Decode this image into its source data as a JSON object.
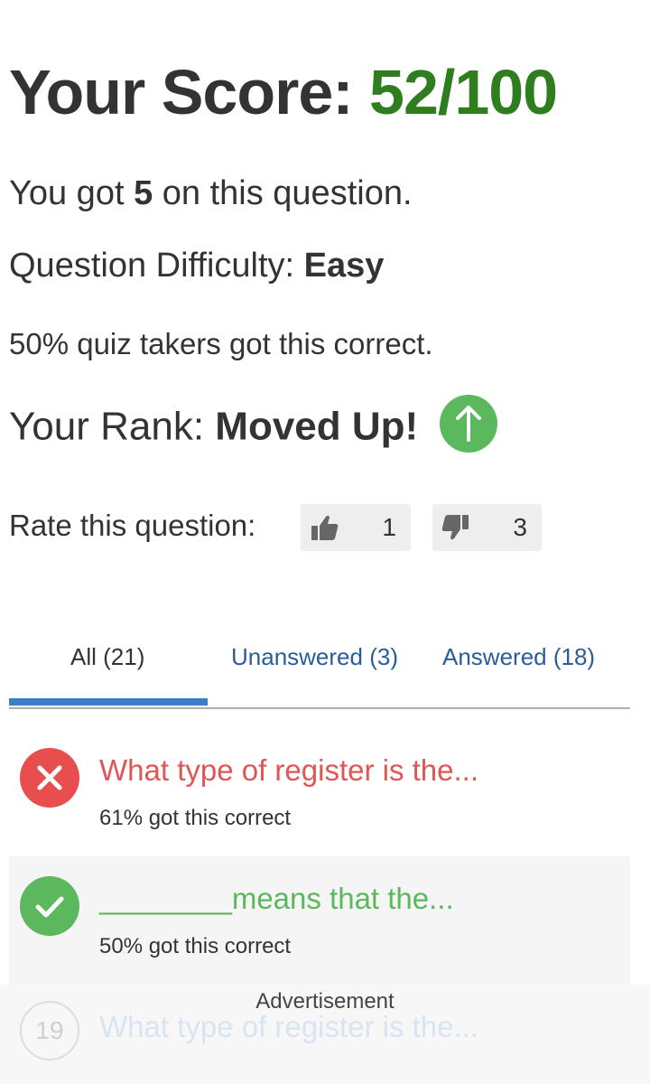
{
  "score": {
    "label": "Your Score:",
    "value": "52/100"
  },
  "result": {
    "prefix": "You got ",
    "points": "5",
    "suffix": " on this question."
  },
  "difficulty": {
    "label": "Question Difficulty: ",
    "value": "Easy"
  },
  "takers_correct": "50% quiz takers got this correct.",
  "rank": {
    "label": "Your Rank: ",
    "value": "Moved Up!",
    "icon": "arrow-up-icon",
    "color": "#5cb85c"
  },
  "rating": {
    "label": "Rate this question:",
    "thumbs_up": {
      "icon": "thumbs-up-icon",
      "count": "1"
    },
    "thumbs_down": {
      "icon": "thumbs-down-icon",
      "count": "3"
    }
  },
  "tabs": [
    {
      "label": "All (21)",
      "active": true
    },
    {
      "label": "Unanswered (3)",
      "active": false
    },
    {
      "label": "Answered (18)",
      "active": false
    }
  ],
  "questions": [
    {
      "status": "incorrect",
      "icon": "x-icon",
      "title": "What type of register is the...",
      "stat": "61% got this correct",
      "color": "#e05555"
    },
    {
      "status": "correct",
      "icon": "check-icon",
      "title": "________means that the...",
      "stat": "50% got this correct",
      "color": "#5cb85c"
    },
    {
      "status": "unanswered",
      "number": "19",
      "title": "What type of register is the..."
    }
  ],
  "advertisement_label": "Advertisement"
}
